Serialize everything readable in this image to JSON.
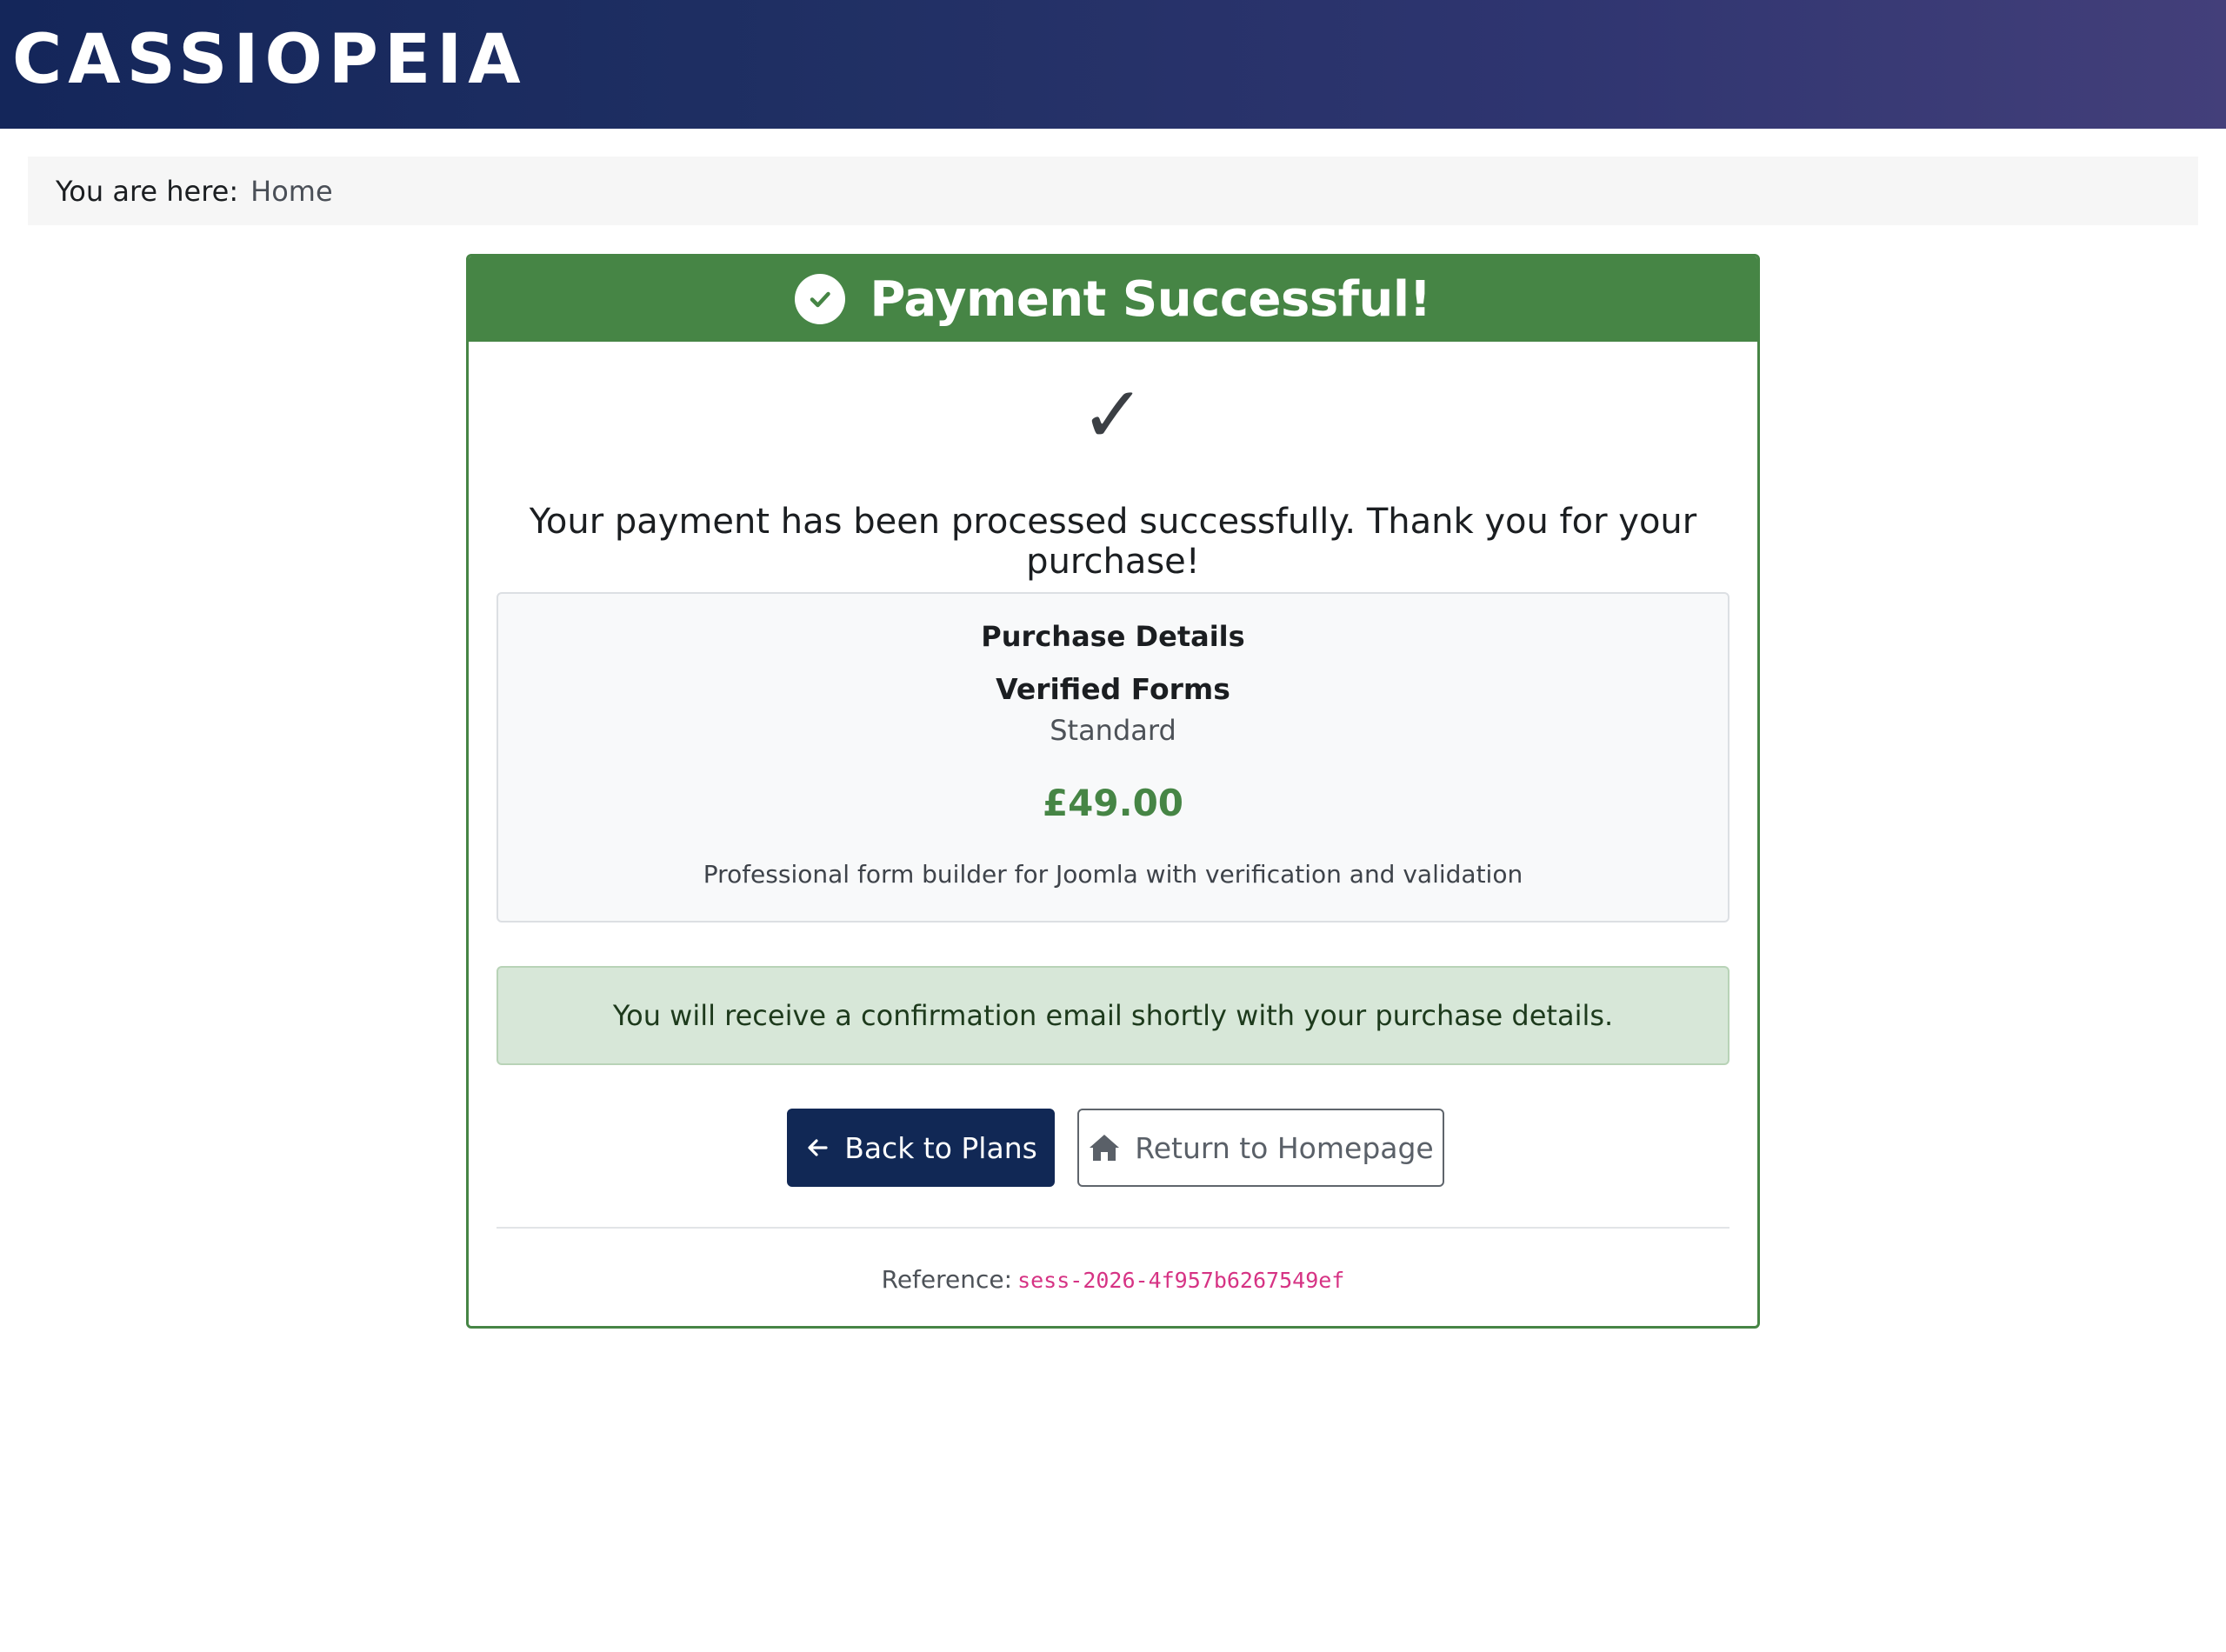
{
  "header": {
    "brand": "CASSIOPEIA"
  },
  "breadcrumb": {
    "label": "You are here:",
    "items": [
      {
        "label": "Home"
      }
    ]
  },
  "card": {
    "title": "Payment Successful!",
    "check_glyph": "✓",
    "lead": "Your payment has been processed successfully. Thank you for your purchase!",
    "details": {
      "heading": "Purchase Details",
      "product": "Verified Forms",
      "plan": "Standard",
      "price": "£49.00",
      "description": "Professional form builder for Joomla with verification and validation"
    },
    "alert": "You will receive a confirmation email shortly with your purchase details.",
    "buttons": {
      "back": {
        "label": "Back to Plans",
        "icon": "arrow-left-icon"
      },
      "home": {
        "label": "Return to Homepage",
        "icon": "home-icon"
      }
    },
    "reference": {
      "label": "Reference:",
      "code": "sess-2026-4f957b6267549ef"
    }
  },
  "colors": {
    "header_gradient_start": "#14265a",
    "header_gradient_end": "#433f7a",
    "success_green": "#468545",
    "primary_button": "#112855",
    "alert_background": "#d7e7d8",
    "reference_code": "#d63384"
  }
}
